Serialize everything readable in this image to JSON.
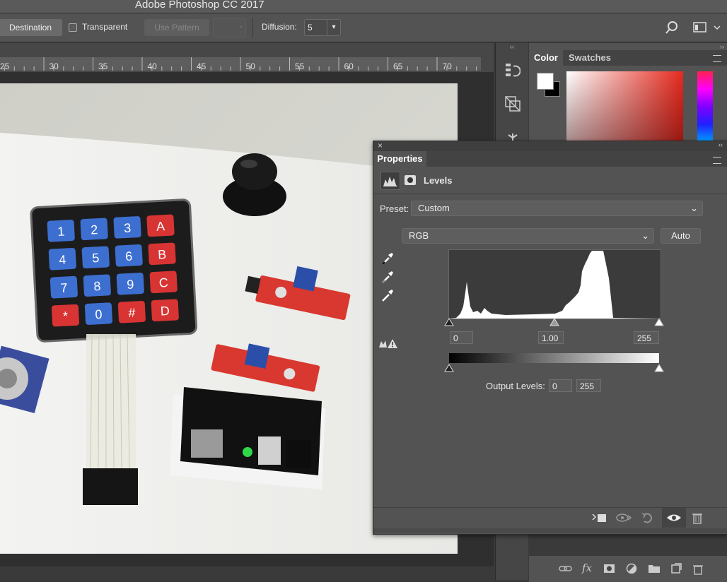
{
  "app": {
    "title": "Adobe Photoshop CC 2017"
  },
  "options_bar": {
    "destination_label": "Destination",
    "transparent_label": "Transparent",
    "use_pattern_label": "Use Pattern",
    "diffusion_label": "Diffusion:",
    "diffusion_value": "5"
  },
  "ruler": {
    "ticks": [
      "25",
      "30",
      "35",
      "40",
      "45",
      "50",
      "55",
      "60",
      "65",
      "70"
    ]
  },
  "color_panel": {
    "tabs": [
      "Color",
      "Swatches"
    ]
  },
  "properties": {
    "title": "Properties",
    "adjustment_name": "Levels",
    "preset_label": "Preset:",
    "preset_value": "Custom",
    "channel_value": "RGB",
    "auto_label": "Auto",
    "input_black": "0",
    "input_gamma": "1.00",
    "input_white": "255",
    "output_label": "Output Levels:",
    "output_black": "0",
    "output_white": "255"
  },
  "photo": {
    "keypad_keys": [
      "1",
      "2",
      "3",
      "A",
      "4",
      "5",
      "6",
      "B",
      "7",
      "8",
      "9",
      "C",
      "*",
      "0",
      "#",
      "D"
    ]
  },
  "colors": {
    "ui_bg": "#535353",
    "canvas_bg": "#2f2f2f",
    "accent_red": "#d93434",
    "key_blue": "#3d6fd1"
  }
}
